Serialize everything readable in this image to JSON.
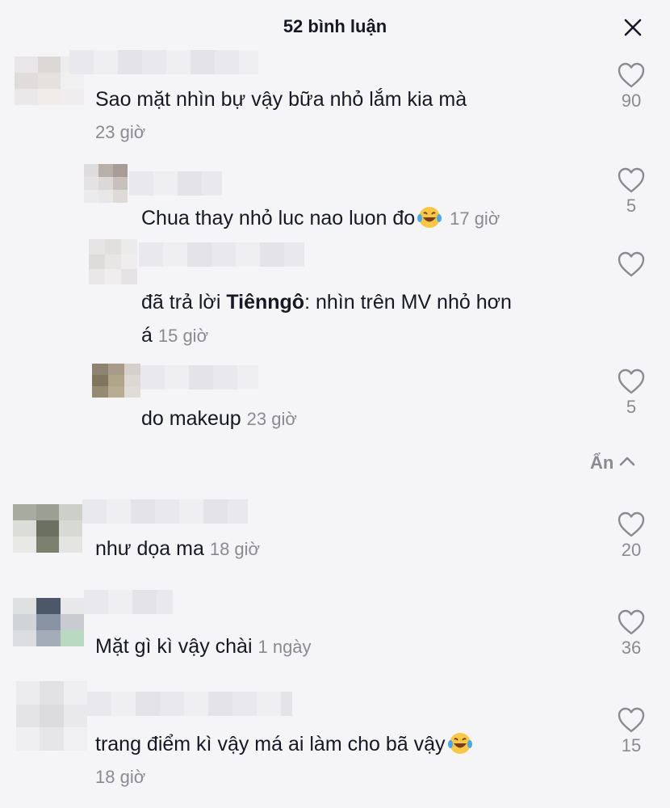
{
  "header": {
    "title": "52 bình luận"
  },
  "icons": {
    "close": "close-icon",
    "like": "heart-outline-icon",
    "hide": "chevron-up-icon",
    "emoji": "laughing-tears-emoji-icon"
  },
  "colors": {
    "text": "#161823",
    "muted": "#8a8b91",
    "background": "#f5f4f6"
  },
  "comments": [
    {
      "text": "Sao mặt nhìn bự vậy bữa nhỏ lắm kia mà",
      "time": "23 giờ",
      "likes": "90"
    },
    {
      "text": "Chua thay nhỏ luc nao luon đo",
      "time": "17 giờ",
      "likes": "5"
    },
    {
      "prefix": "đã trả lời ",
      "mention": "Tiênngô",
      "text": ": nhìn trên MV nhỏ hơn",
      "text2": "á",
      "time": "15 giờ",
      "likes": ""
    },
    {
      "text": "do makeup",
      "time": "23 giờ",
      "likes": "5"
    },
    {
      "text": "như dọa ma",
      "time": "18 giờ",
      "likes": "20"
    },
    {
      "text": "Mặt gì kì vậy chài",
      "time": "1 ngày",
      "likes": "36"
    },
    {
      "text": "trang điểm kì vậy má ai làm cho bã vậy",
      "time": "18 giờ",
      "likes": "15"
    }
  ],
  "hide_label": "Ẩn"
}
